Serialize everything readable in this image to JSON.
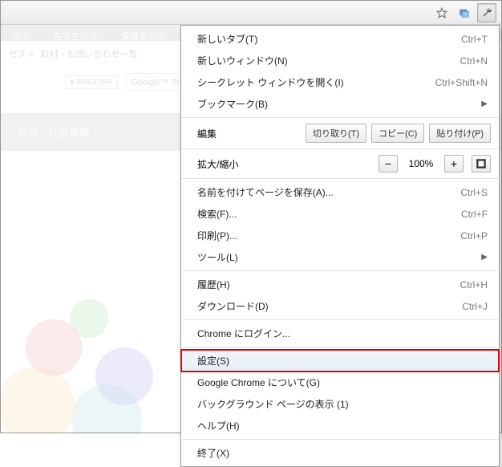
{
  "background": {
    "nav_tabs": [
      "の方",
      "在学生の方",
      "保護者の方"
    ],
    "breadcrumb_sep": "セス  >",
    "breadcrumb_item": "取材・お問い合わせ一覧",
    "english_label": "▸ ENGLISH",
    "google_label": "Google™ カ",
    "page_section": "研究・社会貢献"
  },
  "toolbar": {
    "star_icon": "star-icon",
    "page_icon": "page-icon",
    "wrench_icon": "wrench-icon"
  },
  "menu": {
    "new_tab": "新しいタブ(T)",
    "new_tab_sc": "Ctrl+T",
    "new_window": "新しいウィンドウ(N)",
    "new_window_sc": "Ctrl+N",
    "incognito": "シークレット ウィンドウを開く(I)",
    "incognito_sc": "Ctrl+Shift+N",
    "bookmarks": "ブックマーク(B)",
    "edit_label": "編集",
    "cut": "切り取り(T)",
    "copy": "コピー(C)",
    "paste": "貼り付け(P)",
    "zoom_label": "拡大/縮小",
    "zoom_pct": "100%",
    "save_as": "名前を付けてページを保存(A)...",
    "save_as_sc": "Ctrl+S",
    "find": "検索(F)...",
    "find_sc": "Ctrl+F",
    "print": "印刷(P)...",
    "print_sc": "Ctrl+P",
    "tools": "ツール(L)",
    "history": "履歴(H)",
    "history_sc": "Ctrl+H",
    "downloads": "ダウンロード(D)",
    "downloads_sc": "Ctrl+J",
    "signin": "Chrome にログイン...",
    "settings": "設定(S)",
    "about": "Google Chrome について(G)",
    "bg_pages": "バックグラウンド ページの表示  (1)",
    "help": "ヘルプ(H)",
    "exit": "終了(X)"
  }
}
